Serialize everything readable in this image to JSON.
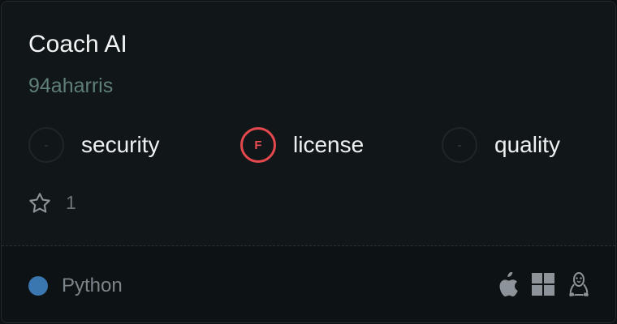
{
  "card": {
    "title": "Coach AI",
    "owner": "94aharris"
  },
  "metrics": [
    {
      "grade": "-",
      "label": "security",
      "status": "none"
    },
    {
      "grade": "F",
      "label": "license",
      "status": "fail"
    },
    {
      "grade": "-",
      "label": "quality",
      "status": "none"
    }
  ],
  "stars": {
    "icon": "star-icon",
    "count": "1"
  },
  "language": {
    "name": "Python",
    "color": "#3a76b0"
  },
  "platforms": [
    "apple-icon",
    "windows-icon",
    "linux-icon"
  ],
  "colors": {
    "fail": "#e5484d",
    "owner": "#5f7f78"
  }
}
